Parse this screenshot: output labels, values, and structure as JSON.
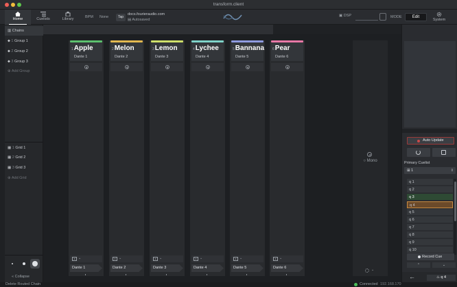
{
  "window": {
    "title": "transform.client"
  },
  "toolbar": {
    "nav": [
      {
        "label": "Home",
        "icon": "home-icon",
        "active": true
      },
      {
        "label": "Cuelists",
        "icon": "list-icon",
        "active": false
      },
      {
        "label": "Library",
        "icon": "library-icon",
        "active": false
      }
    ],
    "bpm_label": "BPM",
    "bpm_value": "None",
    "tap_label": "Tap",
    "doc_url": "docs.fourieraudio.com",
    "autosaved": "Autosaved",
    "dsp_label": "DSP",
    "mode_label": "MODE",
    "mode_value": "Edit",
    "system_label": "System"
  },
  "sidebar": {
    "chains_label": "Chains",
    "groups": [
      {
        "num": "1",
        "label": "Group 1"
      },
      {
        "num": "2",
        "label": "Group 2"
      },
      {
        "num": "3",
        "label": "Group 3"
      }
    ],
    "add_group": "Add Group",
    "grids": [
      {
        "num": "1",
        "label": "Grid 1"
      },
      {
        "num": "2",
        "label": "Grid 2"
      },
      {
        "num": "3",
        "label": "Grid 3"
      }
    ],
    "add_grid": "Add Grid",
    "collapse": "Collapse"
  },
  "channels": [
    {
      "idx": "1",
      "name": "Apple",
      "input": "Dante 1",
      "output": "Dante 1",
      "color": "#5cc06e"
    },
    {
      "idx": "2",
      "name": "Melon",
      "input": "Dante 2",
      "output": "Dante 2",
      "color": "#e2b84f"
    },
    {
      "idx": "3",
      "name": "Lemon",
      "input": "Dante 3",
      "output": "Dante 3",
      "color": "#cfe06a"
    },
    {
      "idx": "4",
      "name": "Lychee",
      "input": "Dante 4",
      "output": "Dante 4",
      "color": "#7fd3c9"
    },
    {
      "idx": "5",
      "name": "Bannana",
      "input": "Dante 5",
      "output": "Dante 5",
      "color": "#8f9be0"
    },
    {
      "idx": "6",
      "name": "Pear",
      "input": "Dante 6",
      "output": "Dante 6",
      "color": "#e878a6"
    }
  ],
  "channel_xbtn_glyph": "x",
  "mono_label": "Mono",
  "right_panel": {
    "auto_update": "Auto Update",
    "primary_cuelist_label": "Primary Cuelist",
    "primary_cuelist_value": "1",
    "cues": [
      "q 1",
      "q 2",
      "q 3",
      "q 4",
      "q 5",
      "q 6",
      "q 7",
      "q 8",
      "q 9",
      "q 10"
    ],
    "record_cue": "Record Cue",
    "current_cue": "q 4"
  },
  "status": {
    "left": "Delete Routed Chain",
    "connected": "Connected",
    "ip": "192.168.170"
  },
  "colors": {
    "accent_red": "#c84a4a",
    "connected_green": "#4cbf5a",
    "cue_active_orange": "#c88a40",
    "cue_active_green": "#2e4a34"
  }
}
